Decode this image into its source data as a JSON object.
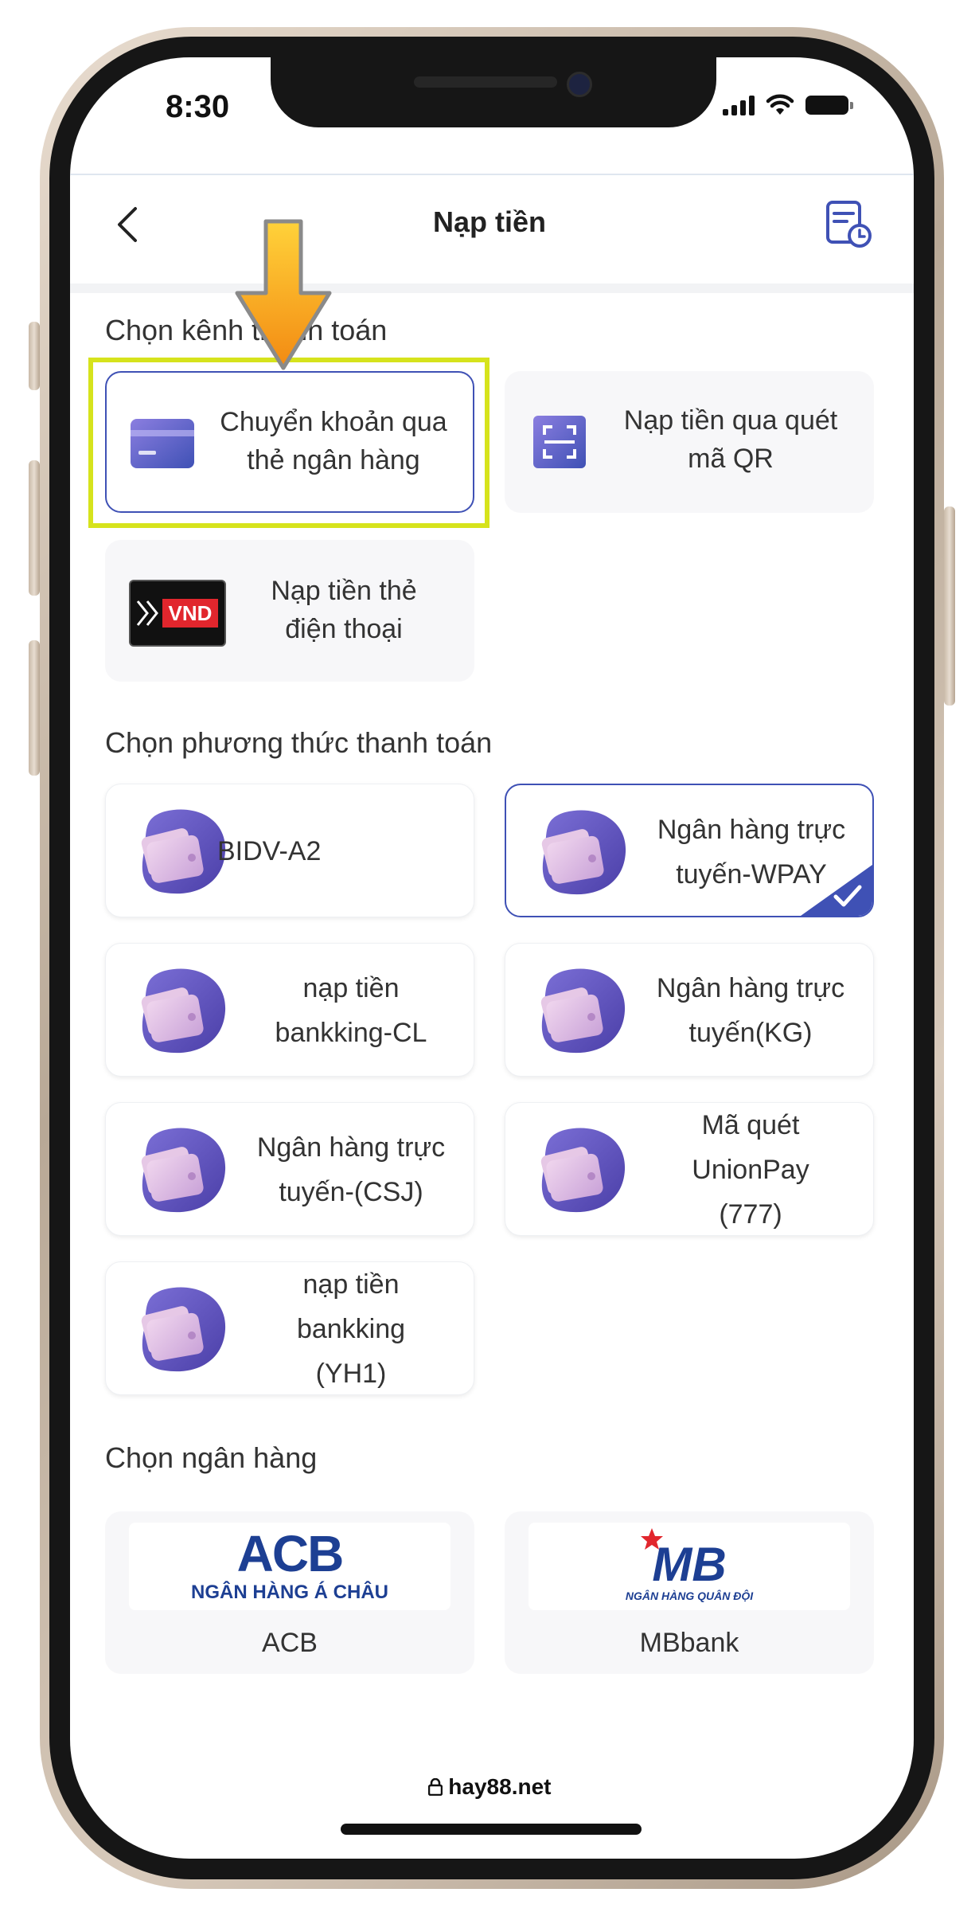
{
  "status_bar": {
    "time": "8:30"
  },
  "header": {
    "title": "Nạp tiền"
  },
  "sections": {
    "channel_title": "Chọn kênh thanh toán",
    "method_title": "Chọn phương thức thanh toán",
    "bank_title": "Chọn ngân hàng"
  },
  "channels": [
    {
      "label_line1": "Chuyển khoản qua",
      "label_line2": "thẻ ngân hàng",
      "icon": "credit-card-icon",
      "selected": true
    },
    {
      "label_line1": "Nạp tiền qua quét",
      "label_line2": "mã QR",
      "icon": "qr-scan-icon"
    },
    {
      "label_line1": "Nạp tiền thẻ",
      "label_line2": "điện thoại",
      "icon": "vnd-card-icon",
      "badge": "VND"
    }
  ],
  "methods": [
    {
      "lines": [
        "BIDV-A2"
      ]
    },
    {
      "lines": [
        "Ngân hàng trực",
        "tuyến-WPAY"
      ],
      "selected": true
    },
    {
      "lines": [
        "nạp tiền",
        "bankking-CL"
      ]
    },
    {
      "lines": [
        "Ngân hàng trực",
        "tuyến(KG)"
      ]
    },
    {
      "lines": [
        "Ngân hàng trực",
        "tuyến-(CSJ)"
      ]
    },
    {
      "lines": [
        "Mã quét",
        "UnionPay",
        "(777)"
      ]
    },
    {
      "lines": [
        "nạp tiền",
        "bankking",
        "(YH1)"
      ]
    }
  ],
  "banks": [
    {
      "name": "ACB",
      "logo_text": "ACB",
      "logo_subtext": "NGÂN HÀNG Á CHÂU"
    },
    {
      "name": "MBbank",
      "logo_text": "MB",
      "logo_subtext": "NGÂN HÀNG QUÂN ĐỘI"
    }
  ],
  "footer": {
    "url": "hay88.net"
  },
  "colors": {
    "accent": "#3f51b5",
    "highlight": "#d6e31c",
    "arrow": "#f7a21b"
  }
}
